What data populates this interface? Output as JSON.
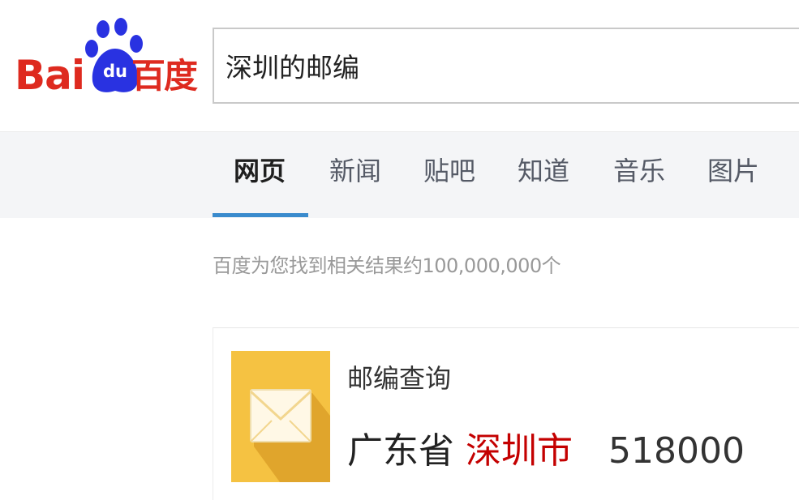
{
  "logo": {
    "latin": "Bai",
    "paw_text": "du",
    "chinese": "百度",
    "brand_red": "#de2a1f",
    "brand_blue": "#2932e1"
  },
  "search": {
    "query": "深圳的邮编"
  },
  "tabs": [
    {
      "label": "网页",
      "active": true
    },
    {
      "label": "新闻",
      "active": false
    },
    {
      "label": "贴吧",
      "active": false
    },
    {
      "label": "知道",
      "active": false
    },
    {
      "label": "音乐",
      "active": false
    },
    {
      "label": "图片",
      "active": false
    }
  ],
  "colors": {
    "tab_underline": "#3a8bcd",
    "city_highlight": "#c40000",
    "mail_tile": "#f5c242"
  },
  "results": {
    "count_text": "百度为您找到相关结果约100,000,000个"
  },
  "postcode_card": {
    "title": "邮编查询",
    "province": "广东省",
    "city": "深圳市",
    "code": "518000",
    "icon": "envelope-icon"
  }
}
